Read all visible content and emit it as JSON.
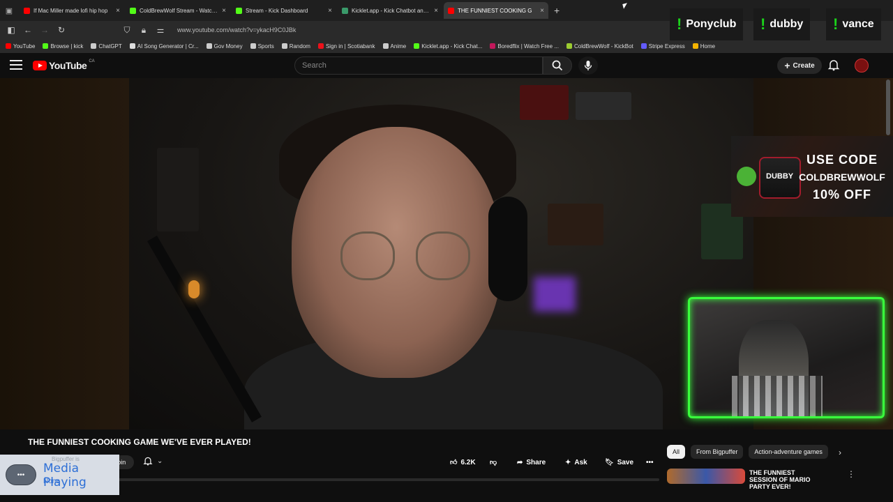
{
  "browser": {
    "tabs": [
      {
        "title": "If Mac Miller made lofi hip hop",
        "favicon_color": "#ff0000",
        "active": false
      },
      {
        "title": "ColdBrewWolf Stream - Watch L",
        "favicon_color": "#53fc18",
        "active": false
      },
      {
        "title": "Stream - Kick Dashboard",
        "favicon_color": "#53fc18",
        "active": false
      },
      {
        "title": "Kicklet.app - Kick Chatbot and C",
        "favicon_color": "#3a9a6a",
        "active": false
      },
      {
        "title": "THE FUNNIEST COOKING G",
        "favicon_color": "#ff0000",
        "active": true
      }
    ],
    "new_tab_icon": "+",
    "url": "www.youtube.com/watch?v=ykacH9C0JBk",
    "bookmarks": [
      {
        "label": "YouTube",
        "color": "#ff0000"
      },
      {
        "label": "Browse | kick",
        "color": "#53fc18"
      },
      {
        "label": "ChatGPT",
        "color": "#cccccc"
      },
      {
        "label": "AI Song Generator | Cr...",
        "color": "#dddddd"
      },
      {
        "label": "Gov Money",
        "color": "#cccccc"
      },
      {
        "label": "Sports",
        "color": "#cccccc"
      },
      {
        "label": "Random",
        "color": "#cccccc"
      },
      {
        "label": "Sign in | Scotiabank",
        "color": "#ec111a"
      },
      {
        "label": "Anime",
        "color": "#cccccc"
      },
      {
        "label": "Kicklet.app - Kick Chat...",
        "color": "#53fc18"
      },
      {
        "label": "Boredflix | Watch Free ...",
        "color": "#c2185b"
      },
      {
        "label": "ColdBrewWolf - KickBot",
        "color": "#9ccc31"
      },
      {
        "label": "Stripe Express",
        "color": "#635bff"
      },
      {
        "label": "Home",
        "color": "#f4b400"
      }
    ]
  },
  "youtube": {
    "logo_text": "YouTube",
    "country": "CA",
    "search_placeholder": "Search",
    "create_label": "Create",
    "accent": "#ff0000"
  },
  "stream_overlay": {
    "commands": [
      {
        "bang": "!",
        "label": "Ponyclub"
      },
      {
        "bang": "!",
        "label": "dubby"
      },
      {
        "bang": "!",
        "label": "vance"
      }
    ],
    "ad": {
      "brand": "DUBBY",
      "line1": "USE CODE",
      "line2": "COLDBREWWOLF",
      "line3": "10% OFF"
    },
    "webcam_border_color": "#39ff3c"
  },
  "video": {
    "title": "THE FUNNIEST COOKING GAME WE'VE EVER PLAYED!",
    "join_label": "Join",
    "likes": "6.2K",
    "share_label": "Share",
    "ask_label": "Ask",
    "save_label": "Save"
  },
  "sidebar": {
    "chips": [
      {
        "label": "All",
        "active": true
      },
      {
        "label": "From Bigpuffer",
        "active": false
      },
      {
        "label": "Action-adventure games",
        "active": false
      }
    ],
    "recommendation": {
      "title": "THE FUNNIEST SESSION OF MARIO PARTY EVER!"
    }
  },
  "media_toast": {
    "faded_text": "Bigpuffer is",
    "title": "Media Playing",
    "subtitle": "None"
  }
}
